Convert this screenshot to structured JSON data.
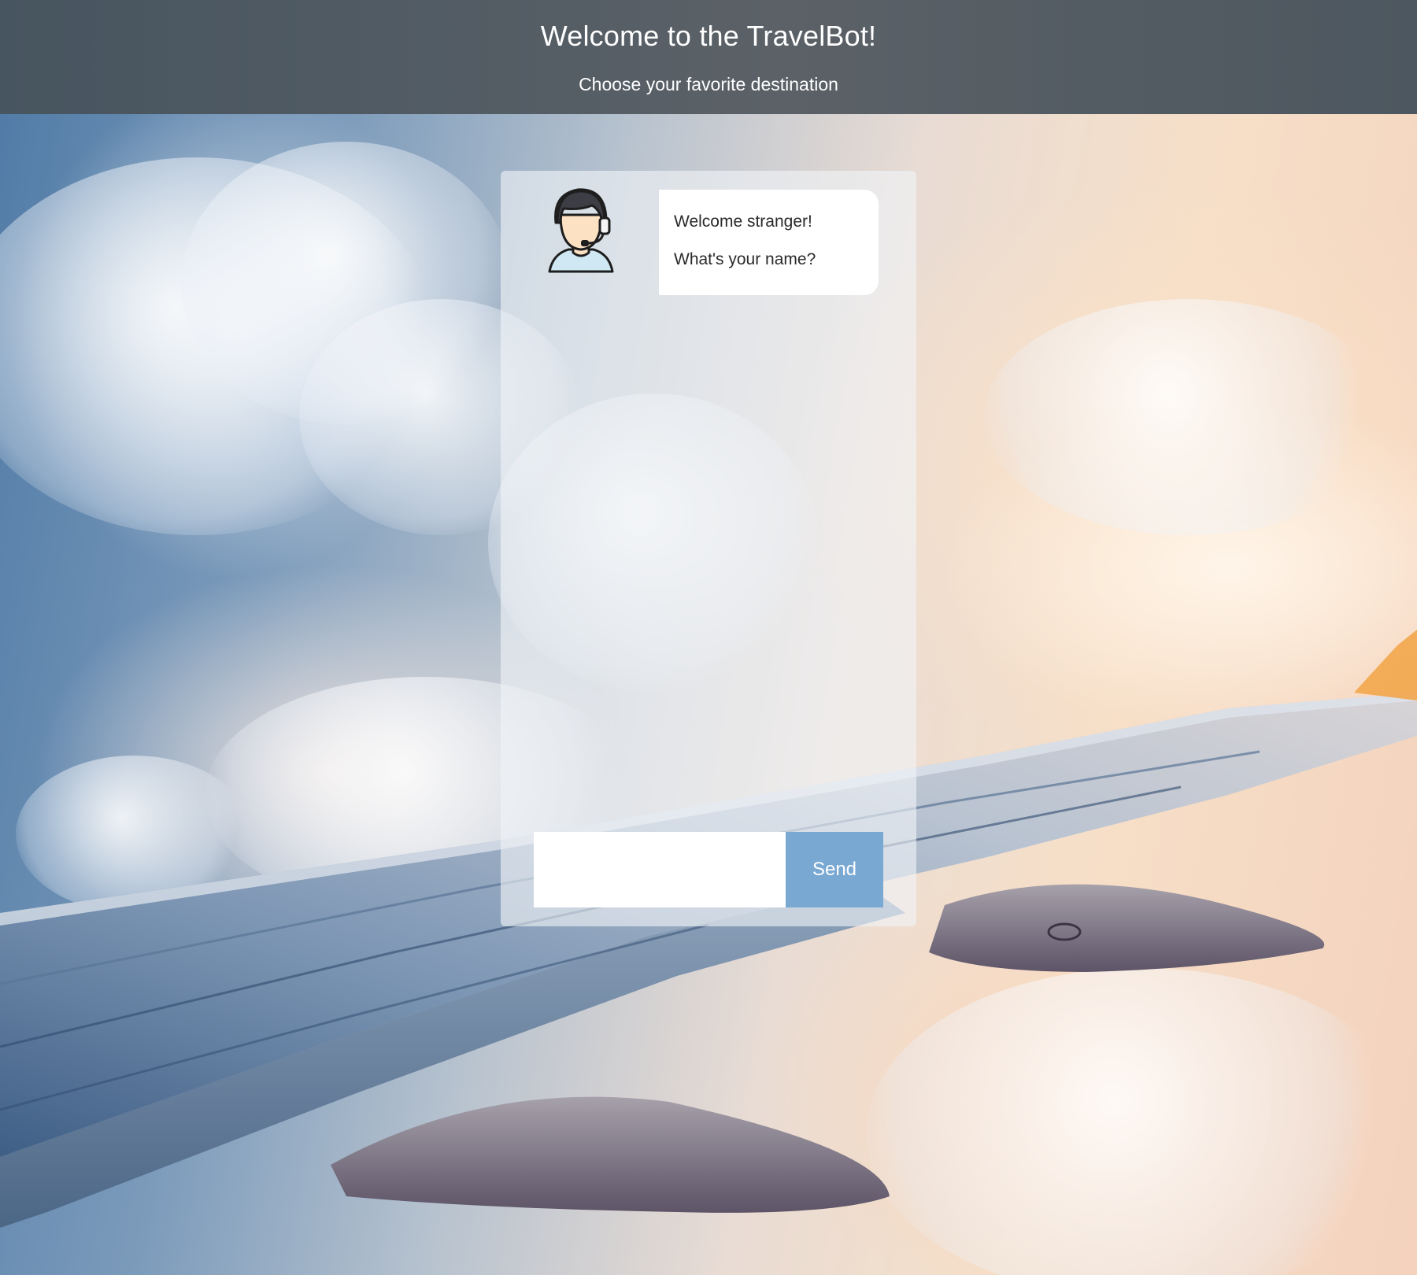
{
  "header": {
    "title": "Welcome to the TravelBot!",
    "subtitle": "Choose your favorite destination"
  },
  "chat": {
    "avatar_icon": "support-agent-headset-icon",
    "messages": [
      {
        "sender": "bot",
        "lines": [
          "Welcome stranger!",
          "What's your name?"
        ]
      }
    ],
    "input": {
      "value": "",
      "placeholder": ""
    },
    "send_label": "Send"
  },
  "colors": {
    "header_bg": "#575e64",
    "send_button": "#79a8d3",
    "bubble_bg": "#ffffff",
    "panel_bg": "rgba(240,243,247,0.62)"
  },
  "background": {
    "subject": "airplane wing above clouds at sunset"
  }
}
